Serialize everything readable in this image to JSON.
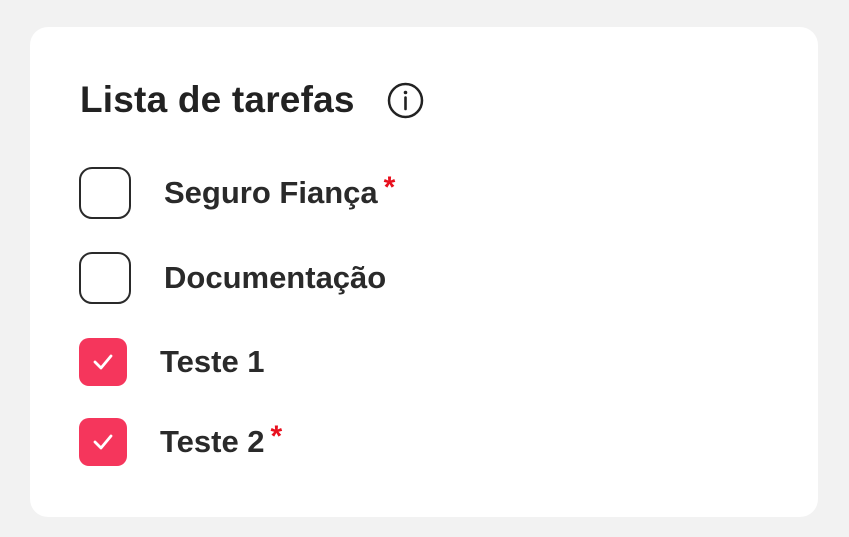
{
  "card": {
    "title": "Lista de tarefas",
    "info_icon": "info-circle-icon"
  },
  "tasks": [
    {
      "label": "Seguro Fiança",
      "checked": false,
      "required": true,
      "required_mark": "*"
    },
    {
      "label": "Documentação",
      "checked": false,
      "required": false,
      "required_mark": ""
    },
    {
      "label": "Teste 1",
      "checked": true,
      "required": false,
      "required_mark": ""
    },
    {
      "label": "Teste 2",
      "checked": true,
      "required": true,
      "required_mark": "*"
    }
  ],
  "colors": {
    "accent": "#f5365c",
    "required": "#e8101e",
    "text": "#2a2a2a",
    "background": "#f2f2f2",
    "card": "#ffffff"
  }
}
